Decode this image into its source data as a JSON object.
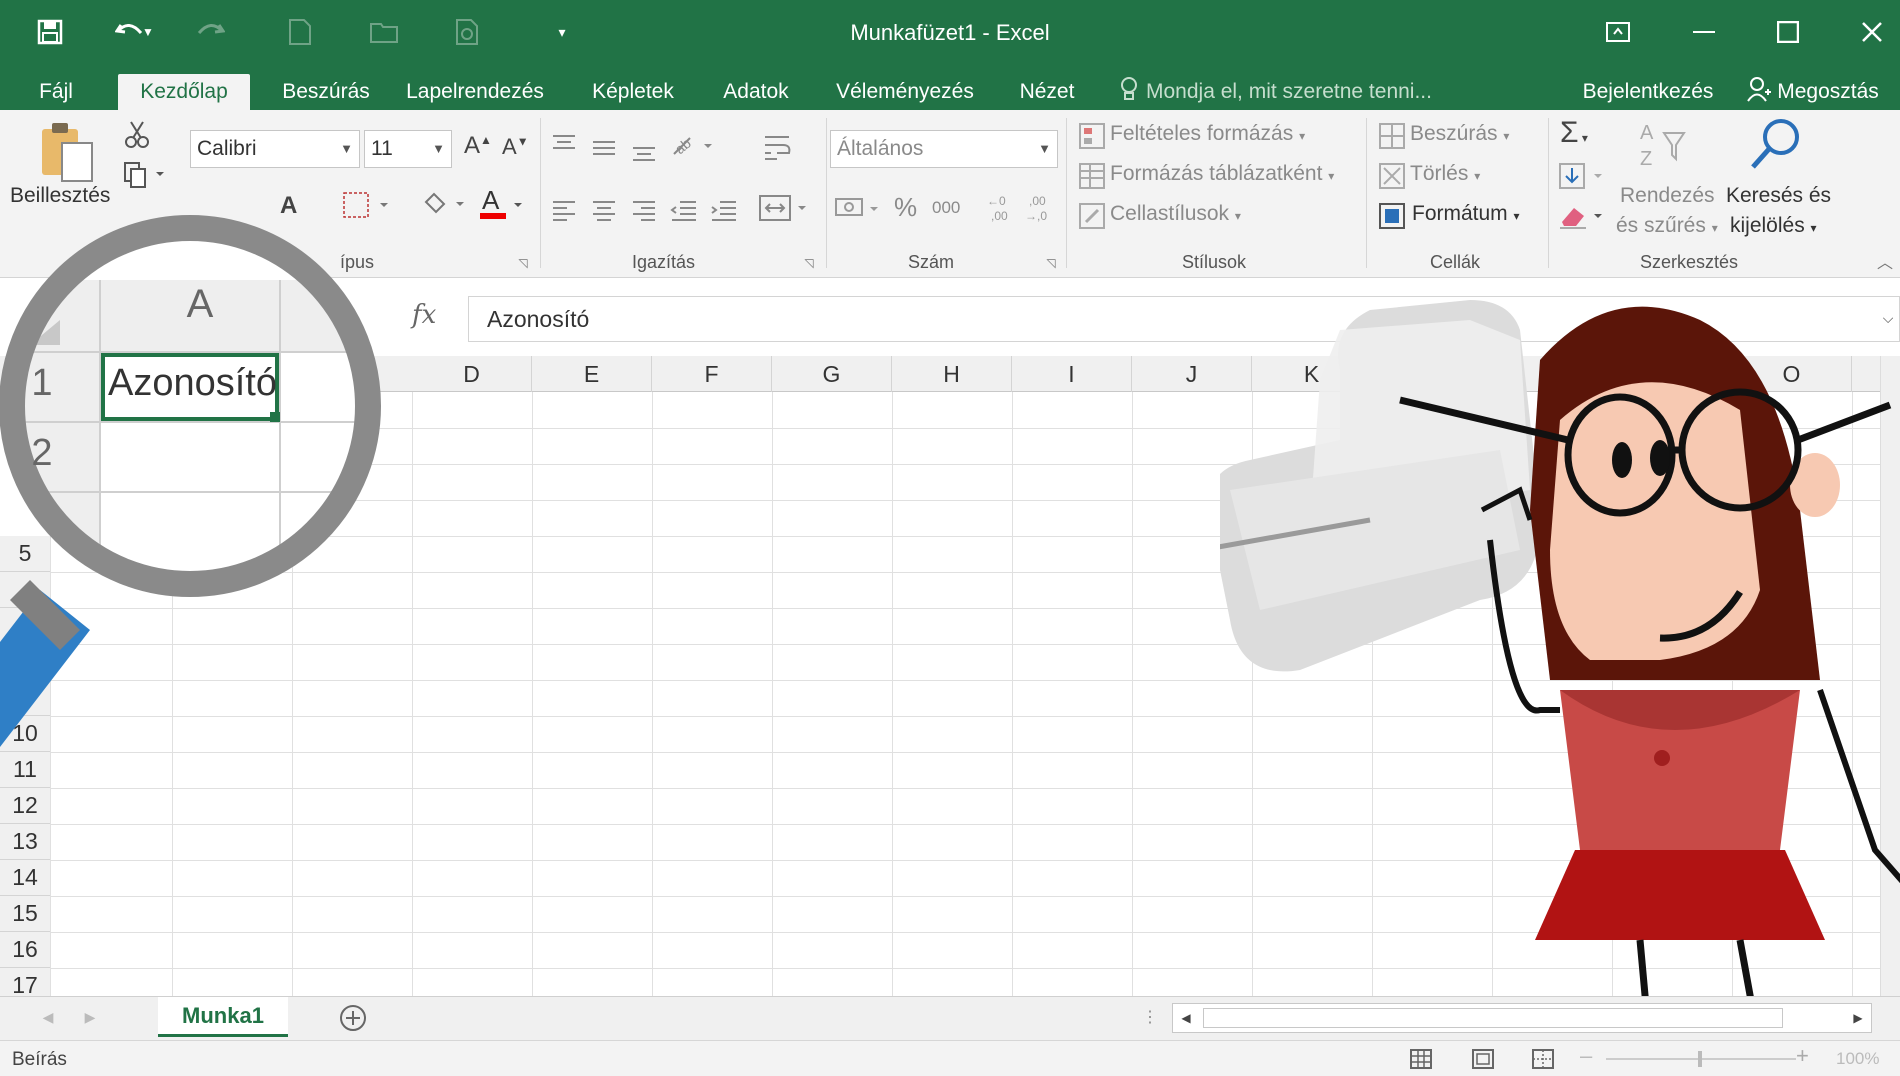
{
  "window": {
    "title": "Munkafüzet1 - Excel"
  },
  "tabs": [
    {
      "label": "Fájl"
    },
    {
      "label": "Kezdőlap"
    },
    {
      "label": "Beszúrás"
    },
    {
      "label": "Lapelrendezés"
    },
    {
      "label": "Képletek"
    },
    {
      "label": "Adatok"
    },
    {
      "label": "Véleményezés"
    },
    {
      "label": "Nézet"
    }
  ],
  "tellme": {
    "placeholder": "Mondja el, mit szeretne tenni..."
  },
  "account": {
    "signin": "Bejelentkezés",
    "share": "Megosztás"
  },
  "ribbon": {
    "paste_label": "Beillesztés",
    "font_name": "Calibri",
    "font_size": "11",
    "font_group_label_partial": "ípus",
    "alignment_label": "Igazítás",
    "number_format": "Általános",
    "number_label": "Szám",
    "percent": "%",
    "thousands": "000",
    "styles": {
      "conditional": "Feltételes formázás",
      "table": "Formázás táblázatként",
      "cell_styles": "Cellastílusok",
      "label": "Stílusok"
    },
    "cells": {
      "insert": "Beszúrás",
      "delete": "Törlés",
      "format": "Formátum",
      "label": "Cellák"
    },
    "editing": {
      "sort_line1": "Rendezés",
      "sort_line2": "és szűrés",
      "find_line1": "Keresés és",
      "find_line2": "kijelölés",
      "label": "Szerkesztés"
    }
  },
  "formula": {
    "fx": "fx",
    "value": "Azonosító"
  },
  "grid": {
    "columns": [
      "D",
      "E",
      "F",
      "G",
      "H",
      "I",
      "J",
      "K",
      "O"
    ],
    "rows": [
      "5",
      "10",
      "11",
      "12",
      "13",
      "14",
      "15",
      "16",
      "17"
    ]
  },
  "magnifier": {
    "col": "A",
    "row1": "1",
    "row2": "2",
    "cell_value": "Azonosító"
  },
  "sheets": [
    {
      "name": "Munka1"
    }
  ],
  "status": {
    "mode": "Beírás",
    "zoom": "100%"
  },
  "colors": {
    "accent": "#217346",
    "ribbon": "#f3f3f3"
  }
}
